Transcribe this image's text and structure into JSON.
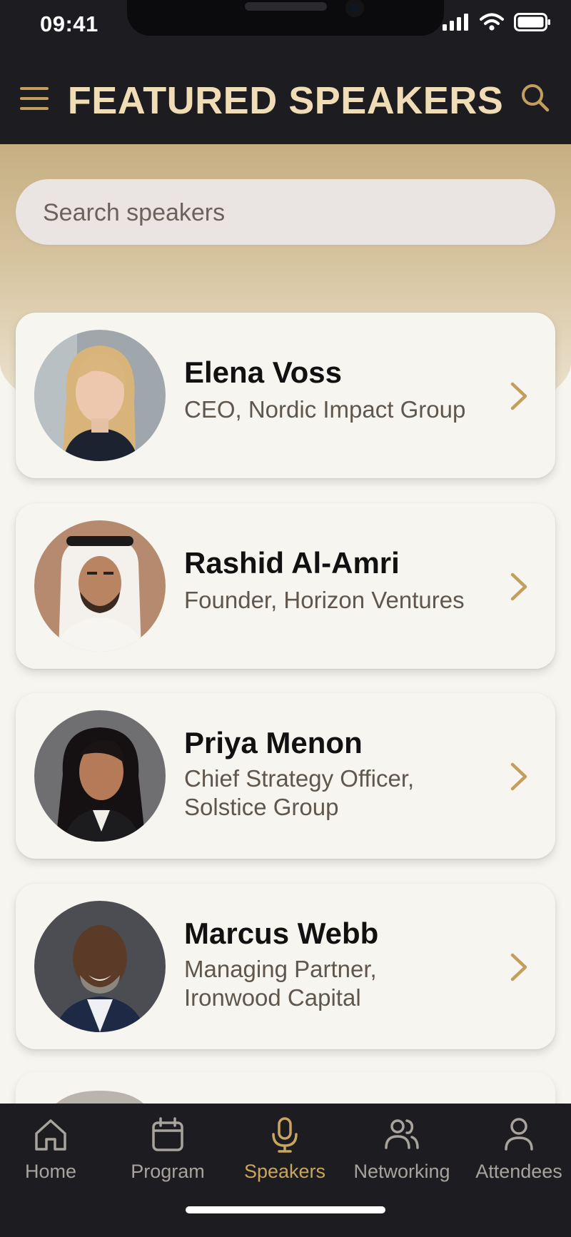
{
  "status_bar": {
    "time": "09:41"
  },
  "header": {
    "title": "FEATURED SPEAKERS",
    "menu_icon": "hamburger-icon",
    "search_icon": "search-icon"
  },
  "search": {
    "placeholder": "Search speakers",
    "value": ""
  },
  "colors": {
    "header_bg": "#1d1c20",
    "title": "#f0ddb6",
    "accent": "#c39e5c",
    "card_bg": "#f7f5f0"
  },
  "speakers": [
    {
      "name": "Elena Voss",
      "role": "CEO, Nordic Impact Group",
      "avatar_icon": "speaker-photo"
    },
    {
      "name": "Rashid Al-Amri",
      "role": "Founder, Horizon Ventures",
      "avatar_icon": "speaker-photo"
    },
    {
      "name": "Priya Menon",
      "role_line1": "Chief Strategy Officer,",
      "role_line2": "Solstice Group",
      "avatar_icon": "speaker-photo"
    },
    {
      "name": "Marcus Webb",
      "role_line1": "Managing Partner,",
      "role_line2": "Ironwood Capital",
      "avatar_icon": "speaker-photo"
    }
  ],
  "tabs": [
    {
      "label": "Home",
      "icon": "home-icon",
      "active": false
    },
    {
      "label": "Program",
      "icon": "calendar-icon",
      "active": false
    },
    {
      "label": "Speakers",
      "icon": "microphone-icon",
      "active": true
    },
    {
      "label": "Networking",
      "icon": "people-icon",
      "active": false
    },
    {
      "label": "Attendees",
      "icon": "person-icon",
      "active": false
    }
  ]
}
